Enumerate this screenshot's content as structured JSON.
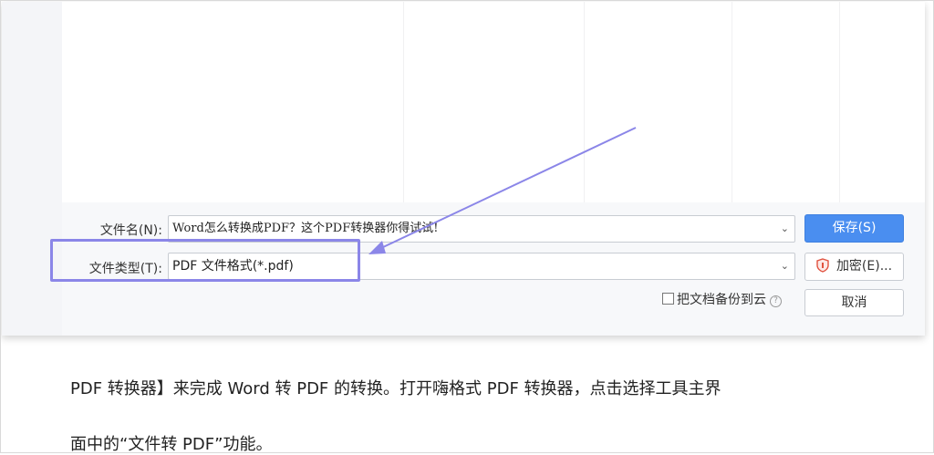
{
  "dialog": {
    "filename_label": "文件名(N):",
    "filename_value": "Word怎么转换成PDF？这个PDF转换器你得试试!",
    "filetype_label": "文件类型(T):",
    "filetype_value": "PDF 文件格式(*.pdf)",
    "save_button": "保存(S)",
    "encrypt_button": "加密(E)...",
    "backup_checkbox_label": "把文档备份到云",
    "backup_checked": false,
    "cancel_button": "取消",
    "dropdown_icon": "chevron-down-icon",
    "shield_icon": "shield-icon",
    "help_icon": "help-icon"
  },
  "annotation": {
    "highlight_color": "#8b86e8",
    "arrow_color": "#8b86e8"
  },
  "article": {
    "line1": "PDF 转换器】来完成 Word 转 PDF 的转换。打开嗨格式 PDF 转换器，点击选择工具主界",
    "line2": "面中的“文件转 PDF”功能。"
  },
  "colors": {
    "primary_button": "#4a8ef0",
    "text": "#222222"
  }
}
